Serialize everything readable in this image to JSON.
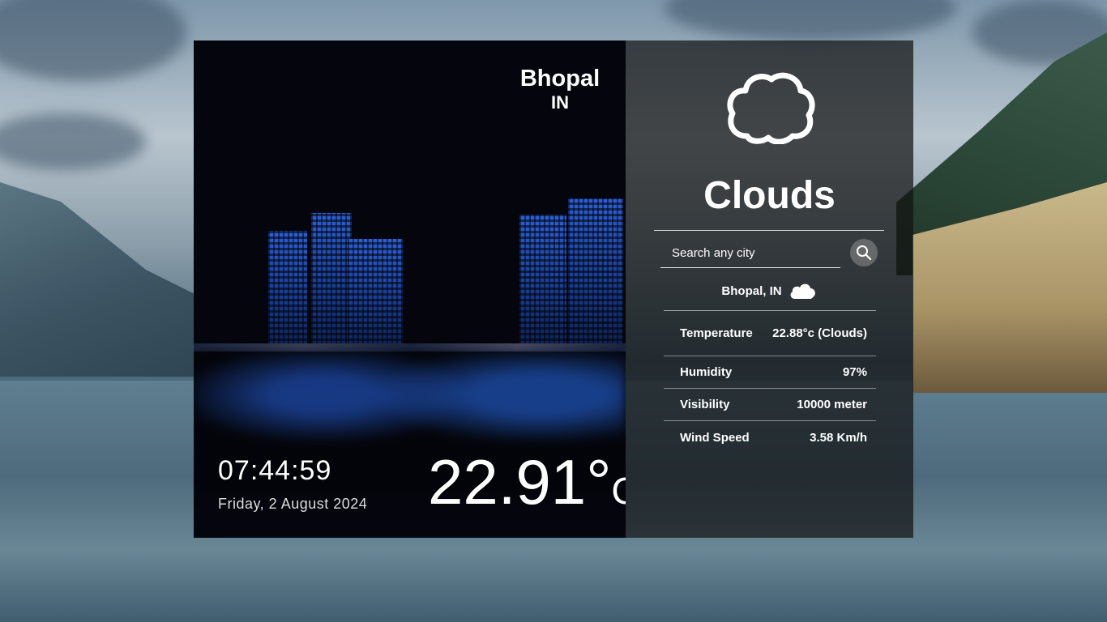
{
  "location": {
    "city": "Bhopal",
    "country": "IN",
    "search_label": "Bhopal, IN"
  },
  "time": {
    "clock": "07:44:59",
    "date": "Friday, 2 August 2024"
  },
  "current": {
    "temperature": "22.91°",
    "unit": "C"
  },
  "condition": {
    "label": "Clouds",
    "icon": "cloud-icon"
  },
  "search": {
    "placeholder": "Search any city",
    "button_icon": "search-icon"
  },
  "stats": [
    {
      "label": "Temperature",
      "value": "22.88°c (Clouds)"
    },
    {
      "label": "Humidity",
      "value": "97%"
    },
    {
      "label": "Visibility",
      "value": "10000 meter"
    },
    {
      "label": "Wind Speed",
      "value": "3.58 Km/h"
    }
  ],
  "colors": {
    "panel_dark": "#05060d",
    "panel_overlay": "rgba(20,20,20,0.72)",
    "text": "#ffffff"
  }
}
